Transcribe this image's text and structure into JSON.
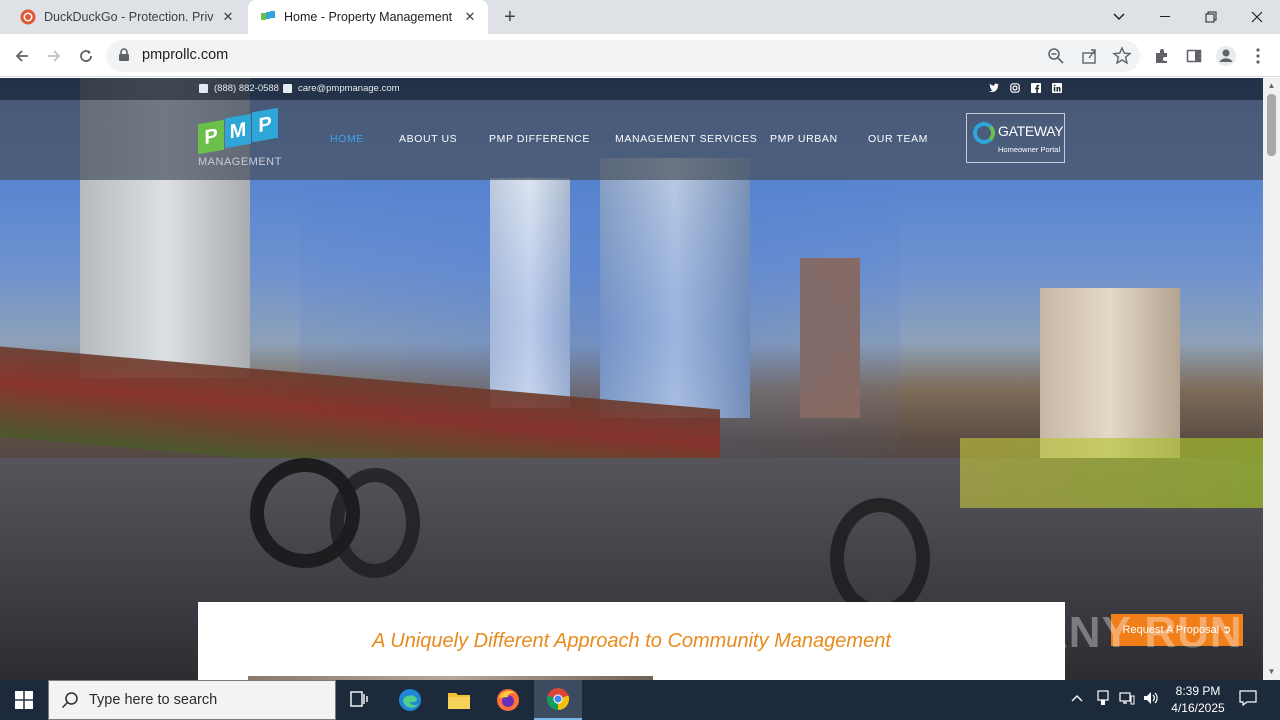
{
  "browser": {
    "tabs": [
      {
        "title": "DuckDuckGo - Protection. Privac",
        "icon": "duckduckgo-icon",
        "active": false
      },
      {
        "title": "Home - Property Management L",
        "icon": "pmp-favicon-icon",
        "active": true
      }
    ],
    "new_tab_icon": "plus-icon",
    "window_controls": [
      "chevron-down-icon",
      "minimize-icon",
      "restore-icon",
      "close-icon"
    ],
    "url": "pmprollc.com"
  },
  "site": {
    "topbar": {
      "phone": "(888) 882-0588",
      "email": "care@pmpmanage.com",
      "social": [
        "twitter-icon",
        "instagram-icon",
        "facebook-icon",
        "linkedin-icon"
      ]
    },
    "logo": {
      "letters": [
        "P",
        "M",
        "P"
      ],
      "word": "MANAGEMENT"
    },
    "nav": [
      {
        "label": "HOME",
        "active": true
      },
      {
        "label": "ABOUT US"
      },
      {
        "label": "PMP DIFFERENCE"
      },
      {
        "label": "MANAGEMENT SERVICES"
      },
      {
        "label": "PMP URBAN"
      },
      {
        "label": "OUR TEAM"
      }
    ],
    "gateway": {
      "name": "GATEWAY",
      "sub": "Homeowner Portal"
    },
    "tagline": "A Uniquely Different Approach to Community Management",
    "proposal_button": "Request A Proposal ➲",
    "watermark": "ANY RUN"
  },
  "taskbar": {
    "search_placeholder": "Type here to search",
    "time": "8:39 PM",
    "date": "4/16/2025",
    "apps": [
      "task-view-icon",
      "edge-icon",
      "file-explorer-icon",
      "firefox-icon",
      "chrome-icon"
    ]
  },
  "colors": {
    "accent_orange": "#e88a1c",
    "nav_active": "#3aa6e8",
    "logo_green": "#6cc04a",
    "logo_blue": "#2fa6d8"
  }
}
